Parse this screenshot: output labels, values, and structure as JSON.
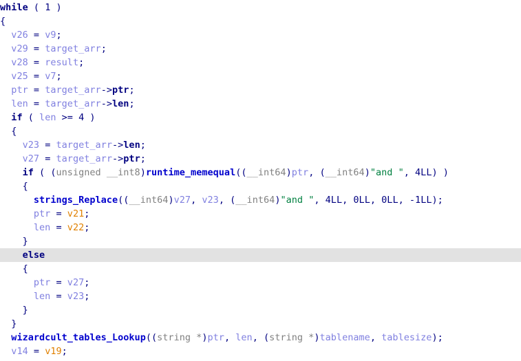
{
  "window": {
    "title": "Hex-Rays Pseudocode",
    "background": "#ffffff",
    "highlight_color": "#e2e2e2",
    "highlighted_line_index": 15
  },
  "colors": {
    "keyword": "#000080",
    "punctuation": "#000080",
    "number": "#000080",
    "variable": "#8080e0",
    "variable_selected": "#e08000",
    "function": "#0000cd",
    "type": "#808080",
    "string": "#008040",
    "member": "#000080"
  },
  "code": {
    "lines": [
      {
        "indent": 0,
        "highlight": false,
        "tokens": [
          {
            "t": "while",
            "c": "kw"
          },
          {
            "t": " ",
            "c": "punct"
          },
          {
            "t": "(",
            "c": "punct"
          },
          {
            "t": " ",
            "c": "punct"
          },
          {
            "t": "1",
            "c": "num"
          },
          {
            "t": " ",
            "c": "punct"
          },
          {
            "t": ")",
            "c": "punct"
          }
        ]
      },
      {
        "indent": 0,
        "highlight": false,
        "tokens": [
          {
            "t": "{",
            "c": "punct"
          }
        ]
      },
      {
        "indent": 1,
        "highlight": false,
        "tokens": [
          {
            "t": "v26",
            "c": "var"
          },
          {
            "t": " = ",
            "c": "punct"
          },
          {
            "t": "v9",
            "c": "var"
          },
          {
            "t": ";",
            "c": "punct"
          }
        ]
      },
      {
        "indent": 1,
        "highlight": false,
        "tokens": [
          {
            "t": "v29",
            "c": "var"
          },
          {
            "t": " = ",
            "c": "punct"
          },
          {
            "t": "target_arr",
            "c": "var"
          },
          {
            "t": ";",
            "c": "punct"
          }
        ]
      },
      {
        "indent": 1,
        "highlight": false,
        "tokens": [
          {
            "t": "v28",
            "c": "var"
          },
          {
            "t": " = ",
            "c": "punct"
          },
          {
            "t": "result",
            "c": "var"
          },
          {
            "t": ";",
            "c": "punct"
          }
        ]
      },
      {
        "indent": 1,
        "highlight": false,
        "tokens": [
          {
            "t": "v25",
            "c": "var"
          },
          {
            "t": " = ",
            "c": "punct"
          },
          {
            "t": "v7",
            "c": "var"
          },
          {
            "t": ";",
            "c": "punct"
          }
        ]
      },
      {
        "indent": 1,
        "highlight": false,
        "tokens": [
          {
            "t": "ptr",
            "c": "var"
          },
          {
            "t": " = ",
            "c": "punct"
          },
          {
            "t": "target_arr",
            "c": "var"
          },
          {
            "t": "->",
            "c": "punct"
          },
          {
            "t": "ptr",
            "c": "memb"
          },
          {
            "t": ";",
            "c": "punct"
          }
        ]
      },
      {
        "indent": 1,
        "highlight": false,
        "tokens": [
          {
            "t": "len",
            "c": "var"
          },
          {
            "t": " = ",
            "c": "punct"
          },
          {
            "t": "target_arr",
            "c": "var"
          },
          {
            "t": "->",
            "c": "punct"
          },
          {
            "t": "len",
            "c": "memb"
          },
          {
            "t": ";",
            "c": "punct"
          }
        ]
      },
      {
        "indent": 1,
        "highlight": false,
        "tokens": [
          {
            "t": "if",
            "c": "kw"
          },
          {
            "t": " ( ",
            "c": "punct"
          },
          {
            "t": "len",
            "c": "var"
          },
          {
            "t": " >= ",
            "c": "punct"
          },
          {
            "t": "4",
            "c": "num"
          },
          {
            "t": " )",
            "c": "punct"
          }
        ]
      },
      {
        "indent": 1,
        "highlight": false,
        "tokens": [
          {
            "t": "{",
            "c": "punct"
          }
        ]
      },
      {
        "indent": 2,
        "highlight": false,
        "tokens": [
          {
            "t": "v23",
            "c": "var"
          },
          {
            "t": " = ",
            "c": "punct"
          },
          {
            "t": "target_arr",
            "c": "var"
          },
          {
            "t": "->",
            "c": "punct"
          },
          {
            "t": "len",
            "c": "memb"
          },
          {
            "t": ";",
            "c": "punct"
          }
        ]
      },
      {
        "indent": 2,
        "highlight": false,
        "tokens": [
          {
            "t": "v27",
            "c": "var"
          },
          {
            "t": " = ",
            "c": "punct"
          },
          {
            "t": "target_arr",
            "c": "var"
          },
          {
            "t": "->",
            "c": "punct"
          },
          {
            "t": "ptr",
            "c": "memb"
          },
          {
            "t": ";",
            "c": "punct"
          }
        ]
      },
      {
        "indent": 2,
        "highlight": false,
        "tokens": [
          {
            "t": "if",
            "c": "kw"
          },
          {
            "t": " ( (",
            "c": "punct"
          },
          {
            "t": "unsigned __int8",
            "c": "type"
          },
          {
            "t": ")",
            "c": "punct"
          },
          {
            "t": "runtime_memequal",
            "c": "func"
          },
          {
            "t": "((",
            "c": "punct"
          },
          {
            "t": "__int64",
            "c": "type"
          },
          {
            "t": ")",
            "c": "punct"
          },
          {
            "t": "ptr",
            "c": "var"
          },
          {
            "t": ", (",
            "c": "punct"
          },
          {
            "t": "__int64",
            "c": "type"
          },
          {
            "t": ")",
            "c": "punct"
          },
          {
            "t": "\"and \"",
            "c": "str"
          },
          {
            "t": ", ",
            "c": "punct"
          },
          {
            "t": "4LL",
            "c": "num"
          },
          {
            "t": ") )",
            "c": "punct"
          }
        ]
      },
      {
        "indent": 2,
        "highlight": false,
        "tokens": [
          {
            "t": "{",
            "c": "punct"
          }
        ]
      },
      {
        "indent": 3,
        "highlight": false,
        "tokens": [
          {
            "t": "strings_Replace",
            "c": "func"
          },
          {
            "t": "((",
            "c": "punct"
          },
          {
            "t": "__int64",
            "c": "type"
          },
          {
            "t": ")",
            "c": "punct"
          },
          {
            "t": "v27",
            "c": "var"
          },
          {
            "t": ", ",
            "c": "punct"
          },
          {
            "t": "v23",
            "c": "var"
          },
          {
            "t": ", (",
            "c": "punct"
          },
          {
            "t": "__int64",
            "c": "type"
          },
          {
            "t": ")",
            "c": "punct"
          },
          {
            "t": "\"and \"",
            "c": "str"
          },
          {
            "t": ", ",
            "c": "punct"
          },
          {
            "t": "4LL",
            "c": "num"
          },
          {
            "t": ", ",
            "c": "punct"
          },
          {
            "t": "0LL",
            "c": "num"
          },
          {
            "t": ", ",
            "c": "punct"
          },
          {
            "t": "0LL",
            "c": "num"
          },
          {
            "t": ", ",
            "c": "punct"
          },
          {
            "t": "-1LL",
            "c": "num"
          },
          {
            "t": ");",
            "c": "punct"
          }
        ]
      },
      {
        "indent": 3,
        "highlight": false,
        "tokens": [
          {
            "t": "ptr",
            "c": "var"
          },
          {
            "t": " = ",
            "c": "punct"
          },
          {
            "t": "v21",
            "c": "varsel"
          },
          {
            "t": ";",
            "c": "punct"
          }
        ]
      },
      {
        "indent": 3,
        "highlight": false,
        "tokens": [
          {
            "t": "len",
            "c": "var"
          },
          {
            "t": " = ",
            "c": "punct"
          },
          {
            "t": "v22",
            "c": "varsel"
          },
          {
            "t": ";",
            "c": "punct"
          }
        ]
      },
      {
        "indent": 2,
        "highlight": false,
        "tokens": [
          {
            "t": "}",
            "c": "punct"
          }
        ]
      },
      {
        "indent": 2,
        "highlight": true,
        "tokens": [
          {
            "t": "else",
            "c": "kw"
          }
        ]
      },
      {
        "indent": 2,
        "highlight": false,
        "tokens": [
          {
            "t": "{",
            "c": "punct"
          }
        ]
      },
      {
        "indent": 3,
        "highlight": false,
        "tokens": [
          {
            "t": "ptr",
            "c": "var"
          },
          {
            "t": " = ",
            "c": "punct"
          },
          {
            "t": "v27",
            "c": "var"
          },
          {
            "t": ";",
            "c": "punct"
          }
        ]
      },
      {
        "indent": 3,
        "highlight": false,
        "tokens": [
          {
            "t": "len",
            "c": "var"
          },
          {
            "t": " = ",
            "c": "punct"
          },
          {
            "t": "v23",
            "c": "var"
          },
          {
            "t": ";",
            "c": "punct"
          }
        ]
      },
      {
        "indent": 2,
        "highlight": false,
        "tokens": [
          {
            "t": "}",
            "c": "punct"
          }
        ]
      },
      {
        "indent": 1,
        "highlight": false,
        "tokens": [
          {
            "t": "}",
            "c": "punct"
          }
        ]
      },
      {
        "indent": 1,
        "highlight": false,
        "tokens": [
          {
            "t": "wizardcult_tables_Lookup",
            "c": "func"
          },
          {
            "t": "((",
            "c": "punct"
          },
          {
            "t": "string *",
            "c": "type"
          },
          {
            "t": ")",
            "c": "punct"
          },
          {
            "t": "ptr",
            "c": "var"
          },
          {
            "t": ", ",
            "c": "punct"
          },
          {
            "t": "len",
            "c": "var"
          },
          {
            "t": ", (",
            "c": "punct"
          },
          {
            "t": "string *",
            "c": "type"
          },
          {
            "t": ")",
            "c": "punct"
          },
          {
            "t": "tablename",
            "c": "var"
          },
          {
            "t": ", ",
            "c": "punct"
          },
          {
            "t": "tablesize",
            "c": "var"
          },
          {
            "t": ");",
            "c": "punct"
          }
        ]
      },
      {
        "indent": 1,
        "highlight": false,
        "tokens": [
          {
            "t": "v14",
            "c": "var"
          },
          {
            "t": " = ",
            "c": "punct"
          },
          {
            "t": "v19",
            "c": "varsel"
          },
          {
            "t": ";",
            "c": "punct"
          }
        ]
      }
    ],
    "indent_unit_spaces": 2
  }
}
